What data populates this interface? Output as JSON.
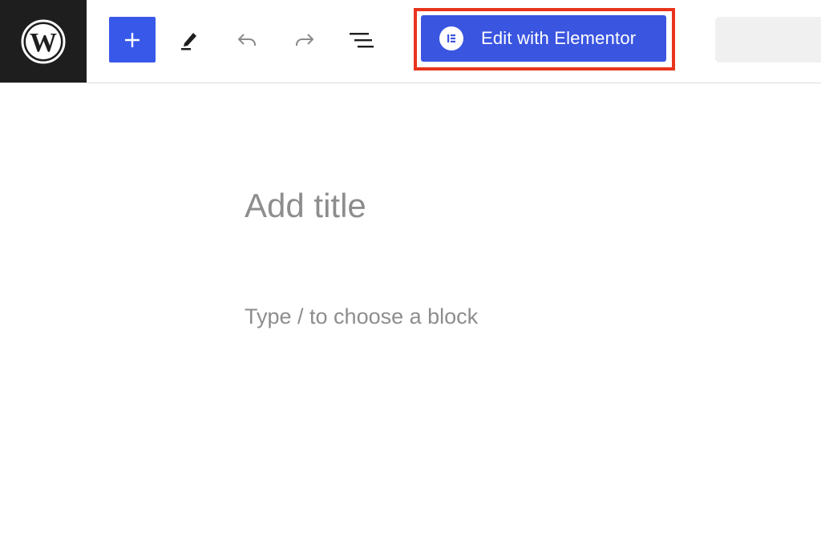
{
  "toolbar": {
    "logo_icon": "wordpress-icon",
    "inserter_icon": "plus-icon",
    "tools": [
      {
        "icon": "pencil-icon"
      },
      {
        "icon": "undo-icon"
      },
      {
        "icon": "redo-icon"
      },
      {
        "icon": "document-overview-icon"
      }
    ],
    "elementor_button": {
      "label": "Edit with Elementor",
      "icon": "elementor-icon",
      "color": "#3a55e0",
      "highlight_color": "#e8341c"
    },
    "inserter_color": "#3858e9"
  },
  "editor": {
    "title_placeholder": "Add title",
    "title_value": "",
    "block_placeholder": "Type / to choose a block",
    "block_value": ""
  }
}
